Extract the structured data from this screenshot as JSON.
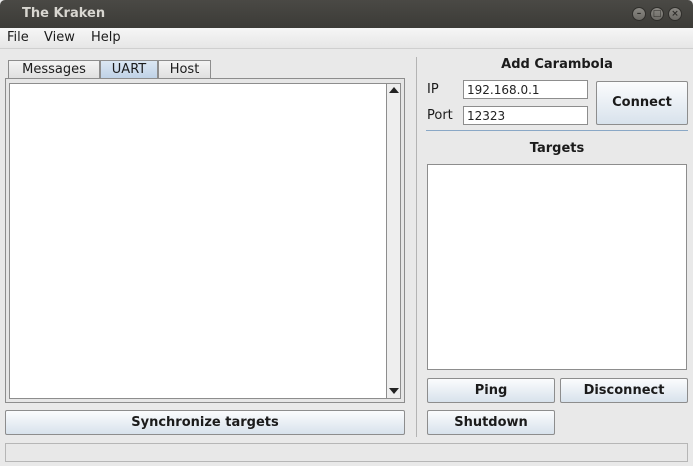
{
  "window": {
    "title": "The Kraken"
  },
  "menu": [
    "File",
    "View",
    "Help"
  ],
  "tabs": [
    {
      "label": "Messages",
      "active": false
    },
    {
      "label": "UART",
      "active": true
    },
    {
      "label": "Host",
      "active": false
    }
  ],
  "left": {
    "sync_button": "Synchronize targets"
  },
  "add_carambola": {
    "heading": "Add Carambola",
    "ip_label": "IP",
    "ip_value": "192.168.0.1",
    "port_label": "Port",
    "port_value": "12323",
    "connect_button": "Connect"
  },
  "targets": {
    "heading": "Targets",
    "ping_button": "Ping",
    "disconnect_button": "Disconnect",
    "shutdown_button": "Shutdown"
  },
  "colors": {
    "active_tab": "#c7d8ea",
    "button_gradient_bottom": "#d8e2ec",
    "titlebar": "#3c3b37"
  }
}
